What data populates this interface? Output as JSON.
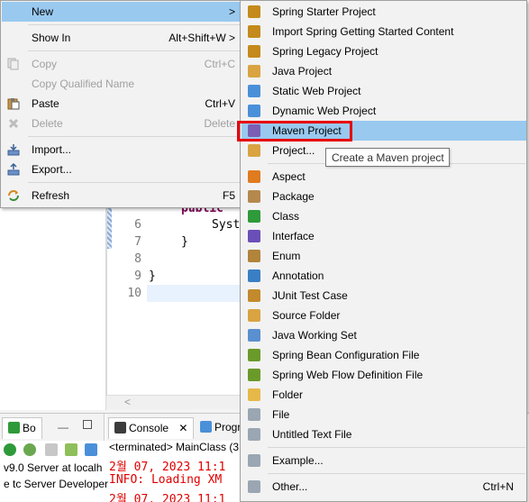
{
  "editor": {
    "line_numbers": [
      "5",
      "6",
      "7",
      "8",
      "9",
      "10"
    ],
    "code_public": "public",
    "code_sys": "Syst",
    "code_brace_close": "}",
    "code_class_close": "}",
    "scroll_glyph": "<"
  },
  "bottom": {
    "views_tab_label": "Bo",
    "console_tab_label": "Console",
    "progress_tab_label": "Progr",
    "server_line_1": "v9.0 Server at localh",
    "server_line_2": "e tc Server Developer",
    "terminated_text": "<terminated> MainClass (3",
    "log_line_1": "2월 07, 2023 11:1",
    "log_line_2": "INFO: Loading XM",
    "log_line_3": "2월 07, 2023 11:1"
  },
  "context_menu": {
    "items": [
      {
        "label": "New",
        "accel": ">",
        "icon": "none",
        "disabled": false,
        "highlighted": true
      },
      {
        "label": "Show In",
        "accel": "Alt+Shift+W >",
        "icon": "none",
        "disabled": false,
        "highlighted": false
      },
      {
        "label": "Copy",
        "accel": "Ctrl+C",
        "icon": "copy-icon",
        "disabled": true,
        "highlighted": false
      },
      {
        "label": "Copy Qualified Name",
        "accel": "",
        "icon": "none",
        "disabled": true,
        "highlighted": false
      },
      {
        "label": "Paste",
        "accel": "Ctrl+V",
        "icon": "paste-icon",
        "disabled": false,
        "highlighted": false
      },
      {
        "label": "Delete",
        "accel": "Delete",
        "icon": "delete-icon",
        "disabled": true,
        "highlighted": false
      },
      {
        "label": "Import...",
        "accel": "",
        "icon": "import-icon",
        "disabled": false,
        "highlighted": false
      },
      {
        "label": "Export...",
        "accel": "",
        "icon": "export-icon",
        "disabled": false,
        "highlighted": false
      },
      {
        "label": "Refresh",
        "accel": "F5",
        "icon": "refresh-icon",
        "disabled": false,
        "highlighted": false
      }
    ]
  },
  "new_submenu": {
    "items": [
      {
        "label": "Spring Starter Project",
        "icon": "spring-starter-icon",
        "color": "#c48a1b"
      },
      {
        "label": "Import Spring Getting Started Content",
        "icon": "spring-import-icon",
        "color": "#c48a1b"
      },
      {
        "label": "Spring Legacy Project",
        "icon": "spring-legacy-icon",
        "color": "#c48a1b"
      },
      {
        "label": "Java Project",
        "icon": "java-project-icon",
        "color": "#d9a441"
      },
      {
        "label": "Static Web Project",
        "icon": "static-web-icon",
        "color": "#4a90d9"
      },
      {
        "label": "Dynamic Web Project",
        "icon": "dynamic-web-icon",
        "color": "#4a90d9"
      },
      {
        "label": "Maven Project",
        "icon": "maven-project-icon",
        "color": "#7a5fb5"
      },
      {
        "label": "Project...",
        "icon": "project-icon",
        "color": "#d9a441"
      },
      {
        "label": "Aspect",
        "icon": "aspect-icon",
        "color": "#e07b1f"
      },
      {
        "label": "Package",
        "icon": "package-icon",
        "color": "#b5894e"
      },
      {
        "label": "Class",
        "icon": "class-icon",
        "color": "#2e9a3a"
      },
      {
        "label": "Interface",
        "icon": "interface-icon",
        "color": "#6b4fb8"
      },
      {
        "label": "Enum",
        "icon": "enum-icon",
        "color": "#b0843a"
      },
      {
        "label": "Annotation",
        "icon": "annotation-icon",
        "color": "#3a7fc4"
      },
      {
        "label": "JUnit Test Case",
        "icon": "junit-icon",
        "color": "#c28a2c"
      },
      {
        "label": "Source Folder",
        "icon": "source-folder-icon",
        "color": "#d9a441"
      },
      {
        "label": "Java Working Set",
        "icon": "working-set-icon",
        "color": "#5a8fd0"
      },
      {
        "label": "Spring Bean Configuration File",
        "icon": "spring-bean-icon",
        "color": "#6a9a2a"
      },
      {
        "label": "Spring Web Flow Definition File",
        "icon": "spring-webflow-icon",
        "color": "#6a9a2a"
      },
      {
        "label": "Folder",
        "icon": "folder-icon",
        "color": "#e6b84a"
      },
      {
        "label": "File",
        "icon": "file-icon",
        "color": "#9aa6b2"
      },
      {
        "label": "Untitled Text File",
        "icon": "text-file-icon",
        "color": "#9aa6b2"
      },
      {
        "label": "Example...",
        "icon": "example-icon",
        "color": "#9aa6b2"
      },
      {
        "label": "Other...",
        "icon": "other-icon",
        "color": "#9aa6b2"
      }
    ],
    "other_accel": "Ctrl+N"
  },
  "tooltip": {
    "text": "Create a Maven project"
  }
}
